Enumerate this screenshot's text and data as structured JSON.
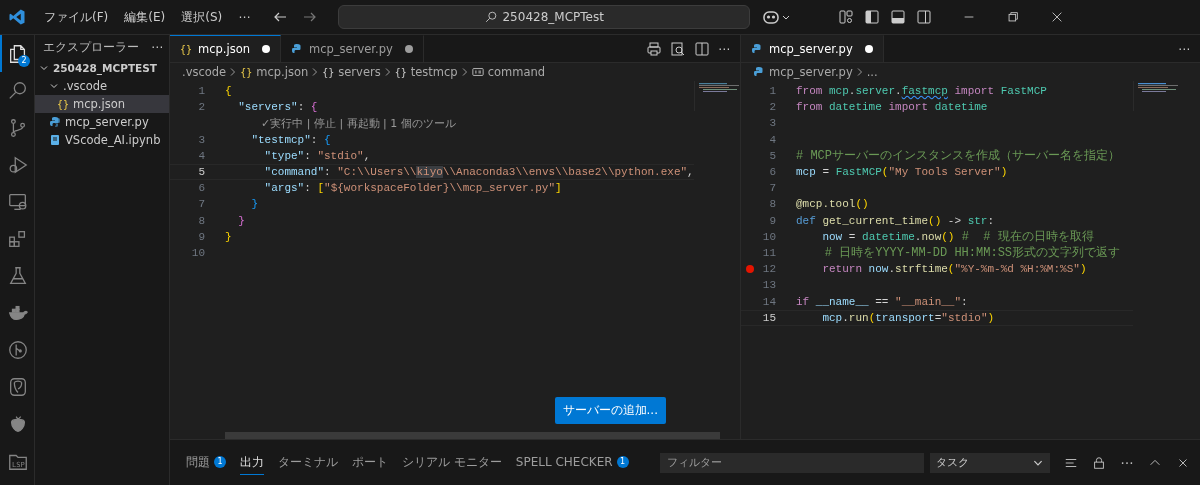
{
  "title_bar": {
    "menus": [
      "ファイル(F)",
      "編集(E)",
      "選択(S)"
    ],
    "more": "⋯",
    "search": "250428_MCPTest"
  },
  "activity_bar": [
    {
      "selected": true,
      "badge": "2"
    },
    {
      "selected": false
    },
    {
      "selected": false
    },
    {
      "selected": false
    },
    {
      "selected": false
    },
    {
      "selected": false
    },
    {
      "selected": false
    },
    {
      "selected": false
    },
    {
      "selected": false
    },
    {
      "selected": false
    },
    {
      "selected": false
    },
    {
      "selected": false,
      "label": "LSP"
    }
  ],
  "sidebar": {
    "title": "エクスプローラー",
    "more": "⋯",
    "tree": [
      {
        "label": "250428_MCPTEST",
        "kind": "root",
        "expanded": true,
        "selected": false,
        "children": [
          {
            "label": ".vscode",
            "kind": "folder",
            "expanded": true,
            "selected": false,
            "children": [
              {
                "label": "mcp.json",
                "kind": "json",
                "icon": "{}",
                "selected": true
              }
            ]
          },
          {
            "label": "mcp_server.py",
            "kind": "python",
            "selected": false
          },
          {
            "label": "VScode_AI.ipynb",
            "kind": "notebook",
            "selected": false
          }
        ]
      }
    ]
  },
  "editors": [
    {
      "focused": true,
      "tabs": [
        {
          "label": "mcp.json",
          "kind": "json",
          "icon": "{}",
          "selected": true,
          "dirty": true
        },
        {
          "label": "mcp_server.py",
          "kind": "python",
          "selected": false,
          "dirty": true
        }
      ],
      "more": "⋯",
      "breadcrumbs": [
        {
          "label": ".vscode",
          "kind": "folder"
        },
        {
          "label": "mcp.json",
          "kind": "json",
          "icon": "{}"
        },
        {
          "label": "servers",
          "kind": "object",
          "icon": "{}"
        },
        {
          "label": "testmcp",
          "kind": "object",
          "icon": "{}"
        },
        {
          "label": "command",
          "kind": "string"
        }
      ],
      "lines": [
        {
          "kind": "code",
          "number": "1",
          "current": false,
          "tokens": [
            {
              "text": "{",
              "kind": "b1"
            }
          ]
        },
        {
          "kind": "code",
          "number": "2",
          "current": false,
          "tokens": [
            {
              "text": "  \"servers\"",
              "kind": "prop"
            },
            {
              "text": ": ",
              "kind": "plain"
            },
            {
              "text": "{",
              "kind": "b2"
            }
          ]
        },
        {
          "kind": "codelens",
          "text": "✓実行中 | 停止 | 再起動 | 1 個のツール"
        },
        {
          "kind": "code",
          "number": "3",
          "current": false,
          "tokens": [
            {
              "text": "    \"testmcp\"",
              "kind": "prop"
            },
            {
              "text": ": ",
              "kind": "plain"
            },
            {
              "text": "{",
              "kind": "b3"
            }
          ]
        },
        {
          "kind": "code",
          "number": "4",
          "current": false,
          "tokens": [
            {
              "text": "      \"type\"",
              "kind": "prop"
            },
            {
              "text": ": ",
              "kind": "plain"
            },
            {
              "text": "\"stdio\"",
              "kind": "str"
            },
            {
              "text": ",",
              "kind": "plain"
            }
          ]
        },
        {
          "kind": "code",
          "number": "5",
          "current": true,
          "tokens": [
            {
              "text": "      \"command\"",
              "kind": "prop"
            },
            {
              "text": ": ",
              "kind": "plain"
            },
            {
              "text": "\"C:\\\\Users\\\\",
              "kind": "str"
            },
            {
              "text": "kiyo",
              "kind": "str",
              "highlight": true
            },
            {
              "text": "\\\\Anaconda3\\\\envs\\\\base2\\\\python.exe\"",
              "kind": "str"
            },
            {
              "text": ",",
              "kind": "plain"
            }
          ]
        },
        {
          "kind": "code",
          "number": "6",
          "current": false,
          "tokens": [
            {
              "text": "      \"args\"",
              "kind": "prop"
            },
            {
              "text": ": ",
              "kind": "plain"
            },
            {
              "text": "[",
              "kind": "b1"
            },
            {
              "text": "\"${workspaceFolder}\\\\mcp_server.py\"",
              "kind": "str"
            },
            {
              "text": "]",
              "kind": "b1"
            }
          ]
        },
        {
          "kind": "code",
          "number": "7",
          "current": false,
          "tokens": [
            {
              "text": "    }",
              "kind": "b3"
            }
          ]
        },
        {
          "kind": "code",
          "number": "8",
          "current": false,
          "tokens": [
            {
              "text": "  }",
              "kind": "b2"
            }
          ]
        },
        {
          "kind": "code",
          "number": "9",
          "current": false,
          "tokens": [
            {
              "text": "}",
              "kind": "b1"
            }
          ]
        },
        {
          "kind": "code",
          "number": "10",
          "current": false
        }
      ],
      "button": "サーバーの追加..."
    },
    {
      "focused": false,
      "tabs": [
        {
          "label": "mcp_server.py",
          "kind": "python",
          "selected": true,
          "dirty": true
        }
      ],
      "more": "⋯",
      "breadcrumbs": [
        {
          "label": "mcp_server.py",
          "kind": "python"
        },
        {
          "label": "...",
          "kind": "more"
        }
      ],
      "lines": [
        {
          "kind": "code",
          "number": "1",
          "current": false,
          "tokens": [
            {
              "text": "from",
              "kind": "kw"
            },
            {
              "text": " mcp",
              "kind": "type"
            },
            {
              "text": ".",
              "kind": "plain"
            },
            {
              "text": "server",
              "kind": "type"
            },
            {
              "text": ".",
              "kind": "plain"
            },
            {
              "text": "fastmcp",
              "kind": "type",
              "squiggle": true
            },
            {
              "text": " import",
              "kind": "kw"
            },
            {
              "text": " FastMCP",
              "kind": "type"
            }
          ]
        },
        {
          "kind": "code",
          "number": "2",
          "current": false,
          "tokens": [
            {
              "text": "from",
              "kind": "kw"
            },
            {
              "text": " datetime",
              "kind": "type"
            },
            {
              "text": " import",
              "kind": "kw"
            },
            {
              "text": " datetime",
              "kind": "type"
            }
          ]
        },
        {
          "kind": "code",
          "number": "3",
          "current": false
        },
        {
          "kind": "code",
          "number": "4",
          "current": false
        },
        {
          "kind": "code",
          "number": "5",
          "current": false,
          "tokens": [
            {
              "text": "# MCPサーバーのインスタンスを作成（サーバー名を指定）",
              "kind": "comment"
            }
          ]
        },
        {
          "kind": "code",
          "number": "6",
          "current": false,
          "tokens": [
            {
              "text": "mcp",
              "kind": "var"
            },
            {
              "text": " = ",
              "kind": "plain"
            },
            {
              "text": "FastMCP",
              "kind": "type"
            },
            {
              "text": "(",
              "kind": "b1"
            },
            {
              "text": "\"My Tools Server\"",
              "kind": "str"
            },
            {
              "text": ")",
              "kind": "b1"
            }
          ]
        },
        {
          "kind": "code",
          "number": "7",
          "current": false
        },
        {
          "kind": "code",
          "number": "8",
          "current": false,
          "tokens": [
            {
              "text": "@mcp.tool",
              "kind": "func"
            },
            {
              "text": "()",
              "kind": "b1"
            }
          ]
        },
        {
          "kind": "code",
          "number": "9",
          "current": false,
          "tokens": [
            {
              "text": "def",
              "kind": "kw2"
            },
            {
              "text": " get_current_time",
              "kind": "func"
            },
            {
              "text": "()",
              "kind": "b1"
            },
            {
              "text": " -> ",
              "kind": "plain"
            },
            {
              "text": "str",
              "kind": "type"
            },
            {
              "text": ":",
              "kind": "plain"
            }
          ]
        },
        {
          "kind": "code",
          "number": "10",
          "current": false,
          "tokens": [
            {
              "text": "    now",
              "kind": "var"
            },
            {
              "text": " = ",
              "kind": "plain"
            },
            {
              "text": "datetime",
              "kind": "type"
            },
            {
              "text": ".",
              "kind": "plain"
            },
            {
              "text": "now",
              "kind": "func"
            },
            {
              "text": "()",
              "kind": "b1"
            },
            {
              "text": " #  # 現在の日時を取得",
              "kind": "comment"
            }
          ]
        },
        {
          "kind": "code",
          "number": "11",
          "current": false,
          "tokens": [
            {
              "text": "    # 日時をYYYY-MM-DD HH:MM:SS形式の文字列で返す",
              "kind": "comment"
            }
          ]
        },
        {
          "kind": "code",
          "number": "12",
          "current": false,
          "breakpoint": true,
          "tokens": [
            {
              "text": "    return",
              "kind": "kw"
            },
            {
              "text": " now",
              "kind": "var"
            },
            {
              "text": ".",
              "kind": "plain"
            },
            {
              "text": "strftime",
              "kind": "func"
            },
            {
              "text": "(",
              "kind": "b1"
            },
            {
              "text": "\"%Y-%m-%d %H:%M:%S\"",
              "kind": "str"
            },
            {
              "text": ")",
              "kind": "b1"
            }
          ]
        },
        {
          "kind": "code",
          "number": "13",
          "current": false
        },
        {
          "kind": "code",
          "number": "14",
          "current": false,
          "tokens": [
            {
              "text": "if",
              "kind": "kw"
            },
            {
              "text": " __name__",
              "kind": "var"
            },
            {
              "text": " == ",
              "kind": "plain"
            },
            {
              "text": "\"__main__\"",
              "kind": "str"
            },
            {
              "text": ":",
              "kind": "plain"
            }
          ]
        },
        {
          "kind": "code",
          "number": "15",
          "current": true,
          "tokens": [
            {
              "text": "    mcp",
              "kind": "var"
            },
            {
              "text": ".",
              "kind": "plain"
            },
            {
              "text": "run",
              "kind": "func"
            },
            {
              "text": "(",
              "kind": "b1"
            },
            {
              "text": "transport",
              "kind": "var"
            },
            {
              "text": "=",
              "kind": "plain"
            },
            {
              "text": "\"stdio\"",
              "kind": "str"
            },
            {
              "text": ")",
              "kind": "b1"
            }
          ]
        }
      ]
    }
  ],
  "panel": {
    "tabs": [
      {
        "label": "問題",
        "badge": "1",
        "selected": false
      },
      {
        "label": "出力",
        "selected": true
      },
      {
        "label": "ターミナル",
        "selected": false
      },
      {
        "label": "ポート",
        "selected": false
      },
      {
        "label": "シリアル モニター",
        "selected": false
      },
      {
        "label": "SPELL CHECKER",
        "badge": "1",
        "selected": false
      }
    ],
    "filter": {
      "placeholder": "フィルター"
    },
    "dropdown": "タスク"
  }
}
